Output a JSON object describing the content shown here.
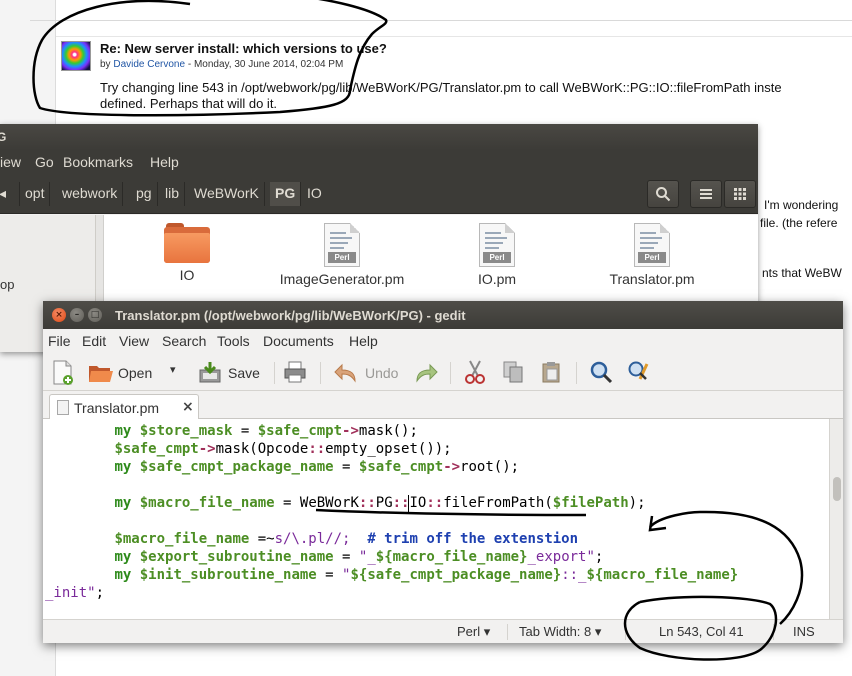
{
  "forum": {
    "post_title": "Re: New server install: which versions to use?",
    "byline_prefix": "by",
    "author": "Davide Cervone",
    "byline_suffix": " - Monday, 30 June 2014, 02:04 PM",
    "body_line1": "Try changing line 543 in /opt/webwork/pg/lib/WeBWorK/PG/Translator.pm to call WeBWorK::PG::IO::fileFromPath inste",
    "body_line2": "defined.  Perhaps that will do it.",
    "side_text1": "I'm wondering",
    "side_text2": "file.  (the refere",
    "side_text3": "nts that WeBW"
  },
  "nautilus": {
    "title_fragment": "G",
    "menu": [
      "iew",
      "Go",
      "Bookmarks",
      "Help"
    ],
    "path": [
      "opt",
      "webwork",
      "pg",
      "lib",
      "WeBWorK",
      "PG",
      "IO"
    ],
    "active_crumb": "PG",
    "sidebar_label": "op",
    "files": [
      {
        "name": "IO",
        "icon": "folder-icon"
      },
      {
        "name": "ImageGenerator.pm",
        "icon": "perl-file-icon"
      },
      {
        "name": "IO.pm",
        "icon": "perl-file-icon"
      },
      {
        "name": "Translator.pm",
        "icon": "perl-file-icon"
      }
    ],
    "perl_badge": "Perl"
  },
  "gedit": {
    "title": "Translator.pm (/opt/webwork/pg/lib/WeBWorK/PG) - gedit",
    "menu": [
      "File",
      "Edit",
      "View",
      "Search",
      "Tools",
      "Documents",
      "Help"
    ],
    "toolbar": {
      "open": "Open",
      "save": "Save",
      "undo": "Undo"
    },
    "tab_label": "Translator.pm",
    "tab_close": "×",
    "status": {
      "language": "Perl ▾",
      "tab_width": "Tab Width: 8 ▾",
      "position": "Ln 543, Col 41",
      "mode": "INS"
    }
  },
  "code": {
    "l1": {
      "a": "        ",
      "b": "my",
      "c": " ",
      "d": "$store_mask",
      "e": " = ",
      "f": "$safe_cmpt",
      "g": "->",
      "h": "mask();"
    },
    "l2": {
      "a": "        ",
      "b": "$safe_cmpt",
      "c": "->",
      "d": "mask(Opcode",
      "e": "::",
      "f": "empty_opset());"
    },
    "l3": {
      "a": "        ",
      "b": "my",
      "c": " ",
      "d": "$safe_cmpt_package_name",
      "e": " = ",
      "f": "$safe_cmpt",
      "g": "->",
      "h": "root();"
    },
    "l4": {
      "a": "        ",
      "b": "my",
      "c": " ",
      "d": "$macro_file_name",
      "e": " = ",
      "f": "WeBWorK",
      "g": "::",
      "h": "PG",
      "i": "::",
      "j": "IO",
      "k": "::",
      "l": "fileFromPath(",
      "m": "$filePath",
      "n": ");"
    },
    "l5": {
      "a": "        ",
      "b": "$macro_file_name",
      "c": " =~",
      "d": "s/\\.pl//;",
      "e": "  ",
      "f": "# trim off the extenstion"
    },
    "l6": {
      "a": "        ",
      "b": "my",
      "c": " ",
      "d": "$export_subroutine_name",
      "e": " = ",
      "f": "\"_",
      "g": "${macro_file_name}",
      "h": "_export\"",
      "i": ";"
    },
    "l7": {
      "a": "        ",
      "b": "my",
      "c": " ",
      "d": "$init_subroutine_name",
      "e": " = ",
      "f": "\"",
      "g": "${safe_cmpt_package_name}",
      "h": "::_",
      "i": "${macro_file_name}"
    },
    "l8": {
      "a": "_init\"",
      "b": ";"
    }
  },
  "colors": {
    "accent_close": "#dd4814",
    "title_bar": "#3c3b37",
    "annotation_ink": "#000000"
  }
}
